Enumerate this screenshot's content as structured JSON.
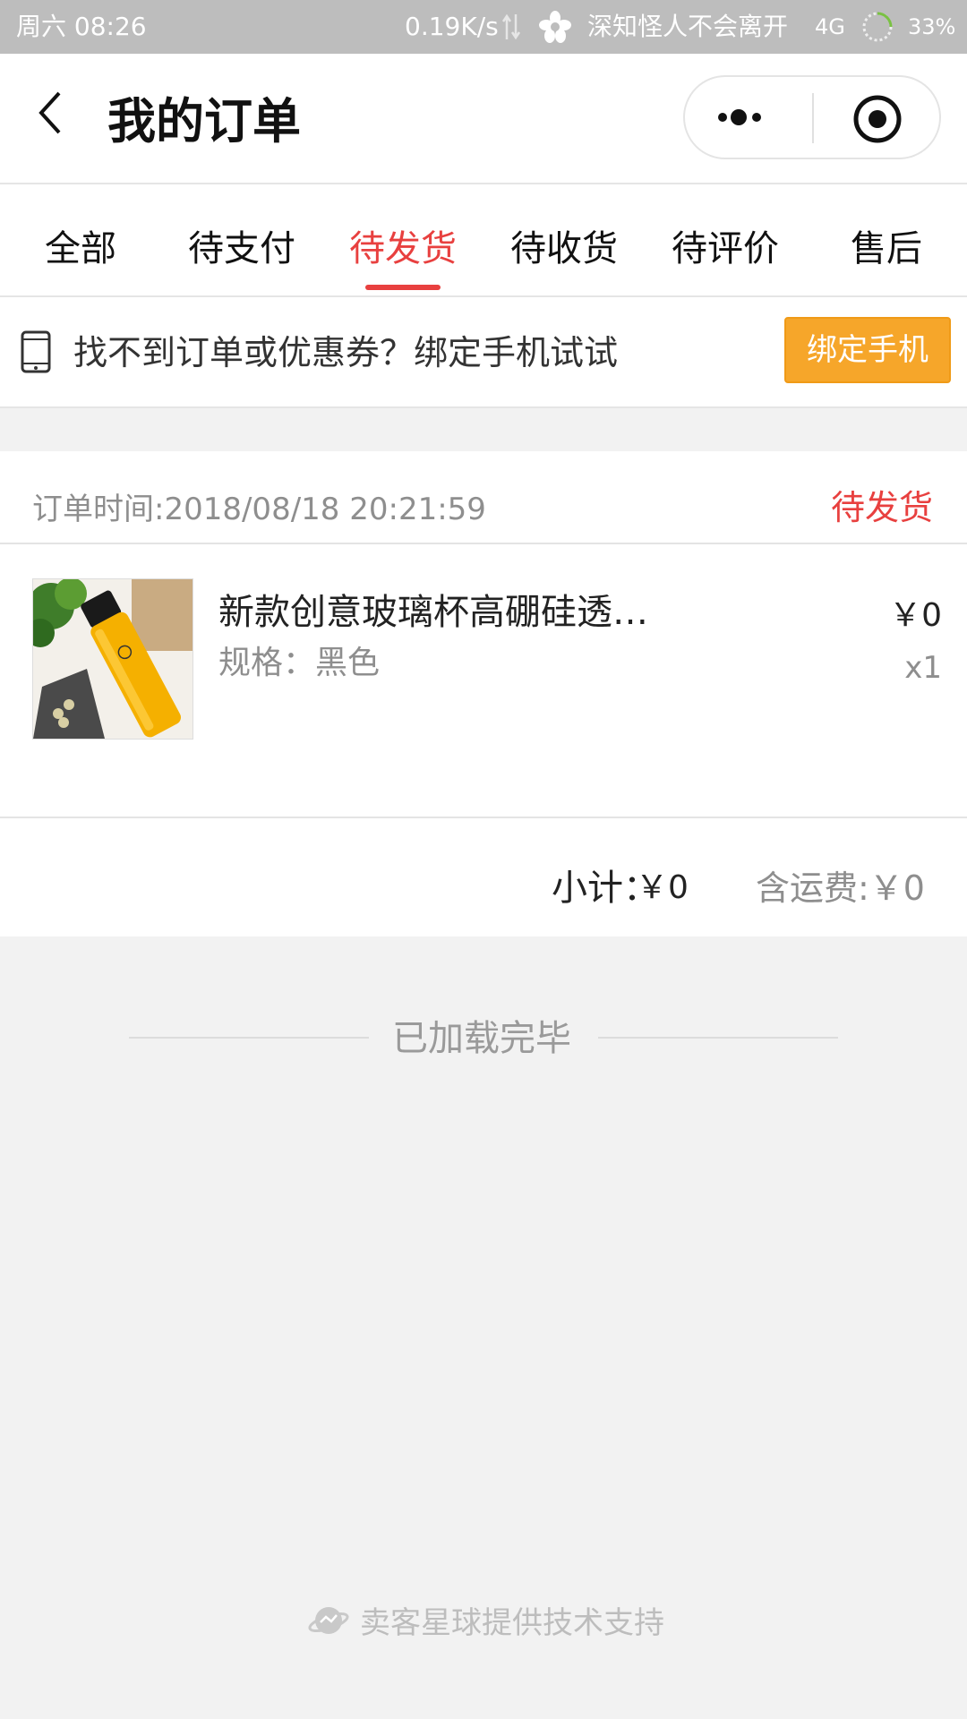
{
  "status_bar": {
    "day_time": "周六 08:26",
    "net_speed": "0.19K/s",
    "carrier": "深知怪人不会离开",
    "network": "4G",
    "battery": "33%",
    "icons": [
      "data-arrows-icon",
      "flower-icon",
      "battery-ring-icon"
    ]
  },
  "nav": {
    "title": "我的订单",
    "back_icon": "chevron-left-icon",
    "more_icon": "more-dots-icon",
    "close_icon": "target-circle-icon"
  },
  "tabs": [
    {
      "label": "全部",
      "active": false
    },
    {
      "label": "待支付",
      "active": false
    },
    {
      "label": "待发货",
      "active": true
    },
    {
      "label": "待收货",
      "active": false
    },
    {
      "label": "待评价",
      "active": false
    },
    {
      "label": "售后",
      "active": false
    }
  ],
  "bind_bar": {
    "icon": "phone-icon",
    "message": "找不到订单或优惠券？绑定手机试试",
    "button_label": "绑定手机"
  },
  "order": {
    "time_label": "订单时间:2018/08/18 20:21:59",
    "status": "待发货",
    "item": {
      "title": "新款创意玻璃杯高硼硅透…",
      "spec": "规格：黑色",
      "price": "￥0",
      "quantity": "x1"
    },
    "subtotal_label": "小计：",
    "subtotal_value": "￥0",
    "shipping": "含运费:￥0"
  },
  "list_end": "已加载完毕",
  "footer": {
    "icon": "planet-logo-icon",
    "text": "卖客星球提供技术支持"
  },
  "colors": {
    "accent_red": "#e8403f",
    "bind_orange": "#f6a62a",
    "status_bar_gray": "#bdbdbd",
    "page_bg": "#f2f2f2"
  }
}
